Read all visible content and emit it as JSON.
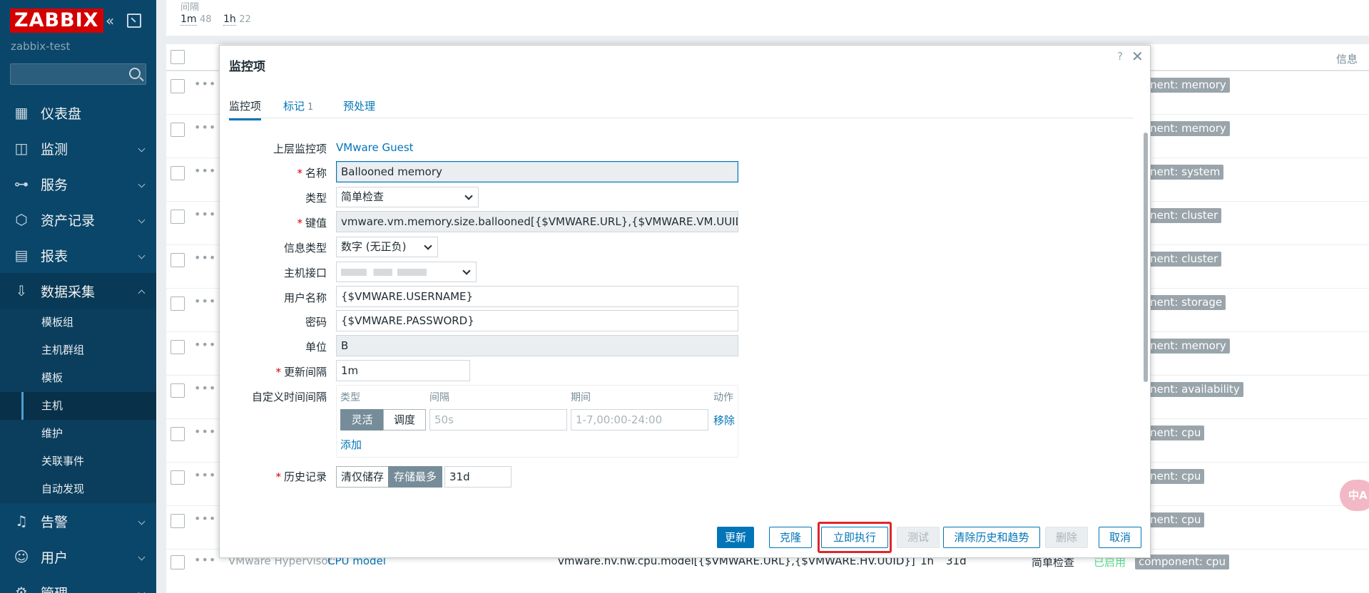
{
  "sidebar": {
    "logo": "ZABBIX",
    "server_name": "zabbix-test",
    "menu": [
      {
        "label": "仪表盘",
        "icon": "dashboard-icon"
      },
      {
        "label": "监测",
        "icon": "monitoring-icon"
      },
      {
        "label": "服务",
        "icon": "services-icon"
      },
      {
        "label": "资产记录",
        "icon": "inventory-icon"
      },
      {
        "label": "报表",
        "icon": "reports-icon"
      },
      {
        "label": "数据采集",
        "icon": "data-collection-icon"
      },
      {
        "label": "告警",
        "icon": "alerts-icon"
      },
      {
        "label": "用户",
        "icon": "users-icon"
      },
      {
        "label": "管理",
        "icon": "administration-icon"
      }
    ],
    "submenu": [
      "模板组",
      "主机群组",
      "模板",
      "主机",
      "维护",
      "关联事件",
      "自动发现"
    ],
    "active_submenu": "主机"
  },
  "filter": {
    "label": "间隔",
    "tags": [
      {
        "tag": "1m",
        "count": "48"
      },
      {
        "tag": "1h",
        "count": "22"
      }
    ]
  },
  "table": {
    "info_header": "信息",
    "tags": [
      "onent: memory",
      "onent: memory",
      "onent: system",
      "onent: cluster",
      "onent: cluster",
      "onent: storage",
      "onent: memory",
      "onent: availability",
      "onent: cpu",
      "onent: cpu",
      "onent: cpu"
    ],
    "last_row": {
      "host": "VMware Hypervisor:",
      "name": "CPU model",
      "key": "vmware.hv.hw.cpu.model[{$VMWARE.URL},{$VMWARE.HV.UUID}]",
      "interval": "1h",
      "history": "31d",
      "type": "简单检查",
      "status": "已启用",
      "tag": "component: cpu"
    }
  },
  "modal": {
    "title": "监控项",
    "help": "?",
    "tabs": [
      {
        "label": "监控项"
      },
      {
        "label": "标记",
        "badge": "1"
      },
      {
        "label": "预处理"
      }
    ],
    "fields": {
      "parent_label": "上层监控项",
      "parent_value": "VMware Guest",
      "name_label": "名称",
      "name_value": "Ballooned memory",
      "type_label": "类型",
      "type_value": "简单检查",
      "key_label": "键值",
      "key_value": "vmware.vm.memory.size.ballooned[{$VMWARE.URL},{$VMWARE.VM.UUID}]",
      "info_type_label": "信息类型",
      "info_type_value": "数字 (无正负)",
      "interface_label": "主机接口",
      "username_label": "用户名称",
      "username_value": "{$VMWARE.USERNAME}",
      "password_label": "密码",
      "password_value": "{$VMWARE.PASSWORD}",
      "units_label": "单位",
      "units_value": "B",
      "interval_label": "更新间隔",
      "interval_value": "1m",
      "custom_label": "自定义时间间隔",
      "history_label": "历史记录"
    },
    "custom_intervals": {
      "col_type": "类型",
      "col_interval": "间隔",
      "col_period": "期间",
      "col_action": "动作",
      "flexible": "灵活",
      "scheduling": "调度",
      "interval_placeholder": "50s",
      "period_placeholder": "1-7,00:00-24:00",
      "remove": "移除",
      "add": "添加"
    },
    "history": {
      "opt1": "清仅储存",
      "opt2": "存储最多",
      "value": "31d"
    },
    "buttons": {
      "update": "更新",
      "clone": "克隆",
      "execute_now": "立即执行",
      "test": "测试",
      "clear_history": "清除历史和趋势",
      "delete": "删除",
      "cancel": "取消"
    }
  },
  "float_button": "中A"
}
